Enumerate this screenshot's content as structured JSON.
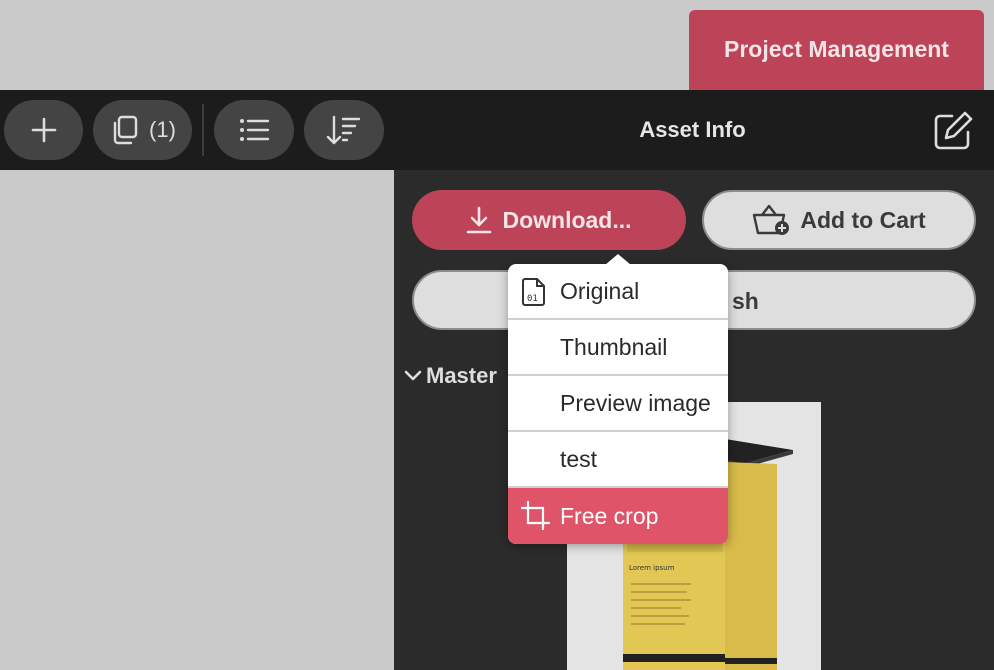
{
  "header": {
    "project_management_label": "Project Management"
  },
  "toolbar": {
    "add_icon": "plus-icon",
    "copy_count": "(1)",
    "list_icon": "list-icon",
    "sort_icon": "sort-icon",
    "title": "Asset Info",
    "edit_icon": "edit-icon"
  },
  "actions": {
    "download_label": "Download...",
    "add_to_cart_label": "Add to Cart",
    "publish_label_visible": "sh"
  },
  "section": {
    "master_label": "Master"
  },
  "download_menu": {
    "items": [
      {
        "label": "Original",
        "icon": "file-binary-icon"
      },
      {
        "label": "Thumbnail"
      },
      {
        "label": "Preview image"
      },
      {
        "label": "test"
      },
      {
        "label": "Free crop",
        "icon": "crop-icon",
        "selected": true
      }
    ]
  },
  "colors": {
    "accent": "#bd4458",
    "menu_selected": "#df5469",
    "toolbar_bg": "#1c1c1c",
    "panel_bg": "#2b2b2b",
    "page_bg": "#cacaca"
  }
}
